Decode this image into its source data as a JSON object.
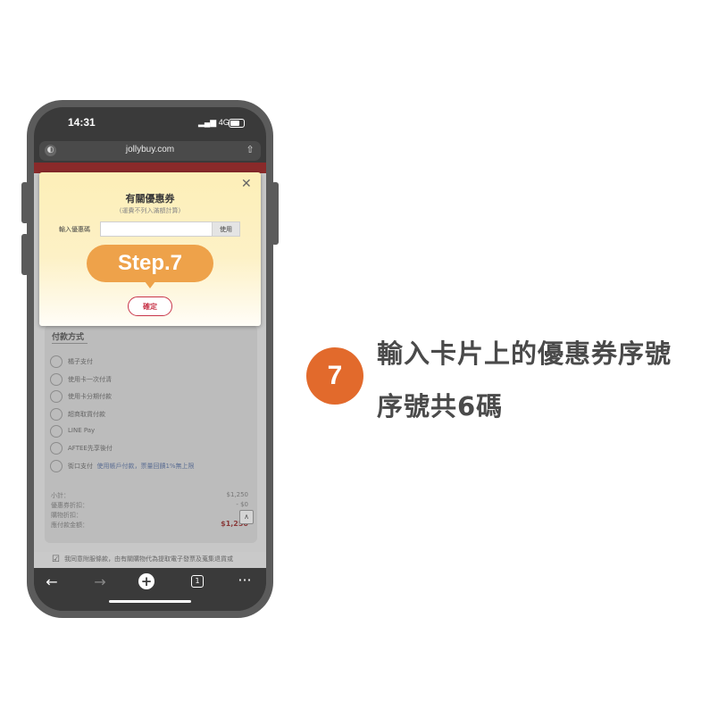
{
  "status_bar": {
    "time": "14:31",
    "network": "4G"
  },
  "browser": {
    "url": "jollybuy.com"
  },
  "modal": {
    "title": "有關優惠券",
    "subtitle": "(運費不列入滿額計算)",
    "coupon_label": "輸入優惠碼",
    "coupon_value": "",
    "use_button": "使用",
    "step_label": "Step.7",
    "confirm_button": "確定"
  },
  "payment": {
    "section_title": "付款方式",
    "options": [
      {
        "label": "橘子支付",
        "link": ""
      },
      {
        "label": "使用卡一次付清",
        "link": ""
      },
      {
        "label": "使用卡分期付款",
        "link": ""
      },
      {
        "label": "超商取貨付款",
        "link": ""
      },
      {
        "label": "LINE Pay",
        "link": ""
      },
      {
        "label": "AFTEE先享後付",
        "link": ""
      },
      {
        "label": "街口支付",
        "link": "使用帳戶付款，票量回饋1%無上限"
      }
    ]
  },
  "summary": {
    "rows": [
      {
        "label": "小計：",
        "value": "$1,250"
      },
      {
        "label": "優惠券折扣：",
        "value": "- $0"
      },
      {
        "label": "購物折扣：",
        "value": "-"
      },
      {
        "label": "應付款金額：",
        "value": "$1,250"
      }
    ]
  },
  "agreement": {
    "text": "我同意附服條款，由有關購物代為提取電子發票及蒐集退貨或"
  },
  "toolbar": {
    "tab_count": "1"
  },
  "instructions": {
    "step_number": "7",
    "line1": "輸入卡片上的優惠券序號",
    "line2": "序號共6碼"
  },
  "colors": {
    "badge": "#e26a2c",
    "step_pill": "#eea24a",
    "confirm": "#c8364a"
  }
}
